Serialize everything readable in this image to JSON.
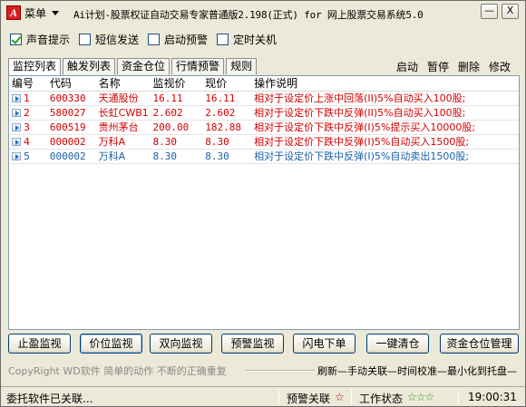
{
  "titlebar": {
    "icon_letter": "A",
    "menu_label": "菜单",
    "title": "Ai计划-股票权证自动交易专家普通版2.198(正式)  for 网上股票交易系统5.0",
    "minimize_label": "—",
    "close_label": "X"
  },
  "options": [
    {
      "label": "声音提示",
      "checked": true
    },
    {
      "label": "短信发送",
      "checked": false
    },
    {
      "label": "启动预警",
      "checked": false
    },
    {
      "label": "定时关机",
      "checked": false
    }
  ],
  "tabs": [
    "监控列表",
    "触发列表",
    "资金仓位",
    "行情预警",
    "规则"
  ],
  "actions": [
    "启动",
    "暂停",
    "删除",
    "修改"
  ],
  "table": {
    "headers": [
      "编号",
      "代码",
      "名称",
      "监视价",
      "现价",
      "操作说明"
    ],
    "rows": [
      {
        "no": "1",
        "code": "600330",
        "name": "天通股份",
        "price": "16.11",
        "current": "16.11",
        "desc": "相对于设定价上涨中回落(II)5%自动买入100股;",
        "color": "red"
      },
      {
        "no": "2",
        "code": "580027",
        "name": "长虹CWB1",
        "price": "2.602",
        "current": "2.602",
        "desc": "相对于设定价下跌中反弹(II)5%自动买入100股;",
        "color": "red"
      },
      {
        "no": "3",
        "code": "600519",
        "name": "贵州茅台",
        "price": "200.00",
        "current": "182.88",
        "desc": "相对于设定价下跌中反弹(I)5%提示买入10000股;",
        "color": "red"
      },
      {
        "no": "4",
        "code": "000002",
        "name": "万科A",
        "price": "8.30",
        "current": "8.30",
        "desc": "相对于设定价下跌中反弹(I)5%自动买入1500股;",
        "color": "red"
      },
      {
        "no": "5",
        "code": "000002",
        "name": "万科A",
        "price": "8.30",
        "current": "8.30",
        "desc": "相对于设定价下跌中反弹(I)5%自动卖出1500股;",
        "color": "blue"
      }
    ]
  },
  "buttons": [
    "止盈监视",
    "价位监视",
    "双向监视",
    "预警监视",
    "闪电下单",
    "一键清仓",
    "资金仓位管理"
  ],
  "footer": {
    "copyright": "CopyRight WD软件  简单的动作  不断的正确重复",
    "slogan": "刷新—手动关联—时间校准—最小化到托盘—"
  },
  "status": {
    "message": "委托软件已关联...",
    "warning_label": "预警关联",
    "warning_star": "☆",
    "work_label": "工作状态",
    "work_stars": "☆☆☆",
    "time": "19:00:31"
  },
  "colors": {
    "red": "#d40000",
    "blue": "#1a5fa8",
    "face": "#ECE9D8"
  }
}
